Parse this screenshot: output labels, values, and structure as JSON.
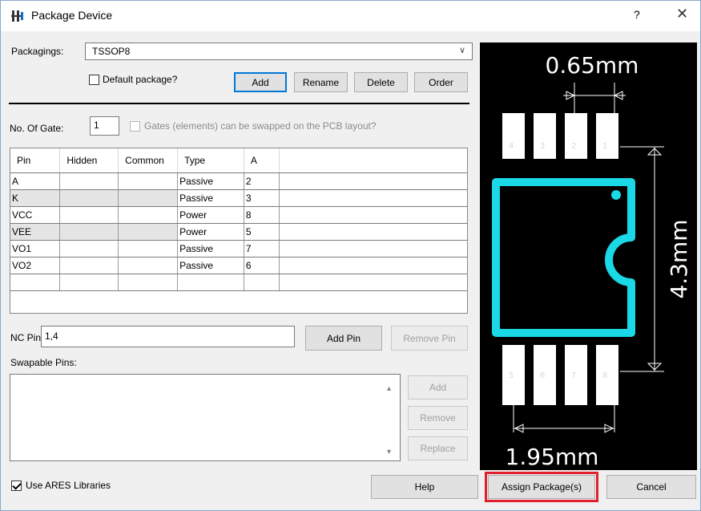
{
  "window": {
    "title": "Package Device",
    "help_glyph": "?",
    "close_glyph": "✕"
  },
  "packagings": {
    "label": "Packagings:",
    "selected": "TSSOP8",
    "arrow": "∨"
  },
  "default_package": {
    "label": "Default package?",
    "checked": false
  },
  "buttons": {
    "add": "Add",
    "rename": "Rename",
    "delete": "Delete",
    "order": "Order",
    "add_pin": "Add Pin",
    "remove_pin": "Remove Pin",
    "swap_add": "Add",
    "swap_remove": "Remove",
    "swap_replace": "Replace",
    "help": "Help",
    "assign": "Assign Package(s)",
    "cancel": "Cancel"
  },
  "gates": {
    "label": "No. Of Gate:",
    "value": "1",
    "swap_label": "Gates (elements) can be swapped on the PCB layout?",
    "swap_checked": false
  },
  "pin_table": {
    "columns": [
      "Pin",
      "Hidden",
      "Common",
      "Type",
      "A"
    ],
    "rows": [
      [
        "A",
        "",
        "",
        "Passive",
        "2"
      ],
      [
        "K",
        "",
        "",
        "Passive",
        "3"
      ],
      [
        "VCC",
        "",
        "",
        "Power",
        "8"
      ],
      [
        "VEE",
        "",
        "",
        "Power",
        "5"
      ],
      [
        "VO1",
        "",
        "",
        "Passive",
        "7"
      ],
      [
        "VO2",
        "",
        "",
        "Passive",
        "6"
      ],
      [
        "",
        "",
        "",
        "",
        ""
      ]
    ]
  },
  "nc_pins": {
    "label": "NC Pins",
    "value": "1,4"
  },
  "swapable_pins": {
    "label": "Swapable Pins:",
    "value": ""
  },
  "use_ares": {
    "label": "Use ARES Libraries",
    "checked": true
  },
  "preview": {
    "dim_pitch": "0.65mm",
    "dim_height": "4.3mm",
    "dim_width": "1.95mm",
    "top_pins": [
      "4",
      "3",
      "2",
      "1"
    ],
    "bottom_pins": [
      "5",
      "6",
      "7",
      "8"
    ],
    "outline_color": "#1ad8e6"
  }
}
